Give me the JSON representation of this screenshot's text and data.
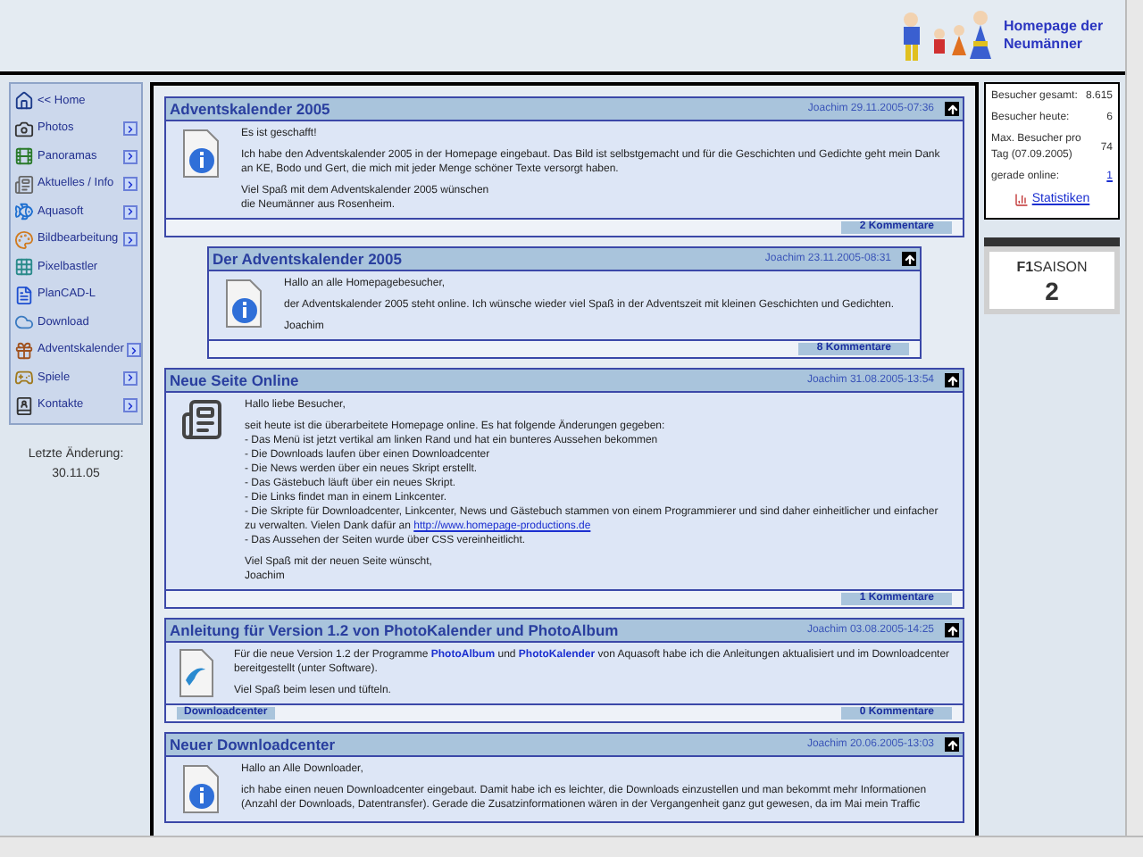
{
  "header": {
    "logo_text": "Homepage der Neumänner"
  },
  "sidebar": {
    "items": [
      {
        "label": "<< Home",
        "submenu": false
      },
      {
        "label": "Photos",
        "submenu": true
      },
      {
        "label": "Panoramas",
        "submenu": true
      },
      {
        "label": "Aktuelles / Info",
        "submenu": true
      },
      {
        "label": "Aquasoft",
        "submenu": true
      },
      {
        "label": "Bildbearbeitung",
        "submenu": true
      },
      {
        "label": "Pixelbastler",
        "submenu": false
      },
      {
        "label": "PlanCAD-L",
        "submenu": false
      },
      {
        "label": "Download",
        "submenu": false
      },
      {
        "label": "Adventskalender",
        "submenu": true
      },
      {
        "label": "Spiele",
        "submenu": true
      },
      {
        "label": "Kontakte",
        "submenu": true
      }
    ],
    "last_change_label": "Letzte Änderung:",
    "last_change_date": "30.11.05"
  },
  "posts": [
    {
      "title": "Adventskalender 2005",
      "meta": "Joachim 29.11.2005-07:36",
      "nested": false,
      "kind": "info",
      "comments": "2 Kommentare",
      "paragraphs": [
        [
          "Es ist geschafft!"
        ],
        [
          "Ich habe den Adventskalender 2005 in der Homepage eingebaut. Das Bild ist selbstgemacht und für die Geschichten und Gedichte geht mein Dank an KE, Bodo und Gert, die mich mit jeder Menge schöner Texte versorgt haben."
        ],
        [
          "Viel Spaß mit dem Adventskalender 2005 wünschen",
          "die Neumänner aus Rosenheim."
        ]
      ]
    },
    {
      "title": "Der Adventskalender 2005",
      "meta": "Joachim 23.11.2005-08:31",
      "nested": true,
      "kind": "info",
      "comments": "8 Kommentare",
      "paragraphs": [
        [
          "Hallo an alle Homepagebesucher,"
        ],
        [
          "der Adventskalender 2005 steht online. Ich wünsche wieder viel Spaß in der Adventszeit mit kleinen Geschichten und Gedichten."
        ],
        [
          "Joachim"
        ]
      ]
    },
    {
      "title": "Neue Seite Online",
      "meta": "Joachim 31.08.2005-13:54",
      "nested": false,
      "kind": "newspaper",
      "comments": "1 Kommentare",
      "paragraphs": [
        [
          "Hallo liebe Besucher,"
        ],
        [
          "seit heute ist die überarbeitete Homepage online. Es hat folgende Änderungen gegeben:",
          "- Das Menü ist jetzt vertikal am linken Rand und hat ein bunteres Aussehen bekommen",
          "- Die Downloads laufen über einen Downloadcenter",
          "- Die News werden über ein neues Skript erstellt.",
          "- Das Gästebuch läuft über ein neues Skript.",
          "- Die Links findet man in einem Linkcenter.",
          [
            {
              "kind": "text",
              "text": "- Die Skripte für Downloadcenter, Linkcenter, News und Gästebuch stammen von einem Programmierer und sind daher einheitlicher und einfacher zu verwalten. Vielen Dank dafür an "
            },
            {
              "kind": "link",
              "text": "http://www.homepage-productions.de"
            }
          ],
          "- Das Aussehen der Seiten wurde über CSS vereinheitlicht."
        ],
        [
          "Viel Spaß mit der neuen Seite wünscht,",
          "Joachim"
        ]
      ]
    },
    {
      "title": "Anleitung für Version 1.2 von PhotoKalender und PhotoAlbum",
      "meta": "Joachim 03.08.2005-14:25",
      "nested": false,
      "kind": "document",
      "footer_link": "Downloadcenter",
      "comments": "0 Kommentare",
      "paragraphs": [
        [
          [
            {
              "kind": "text",
              "text": "Für die neue Version 1.2 der Programme "
            },
            {
              "kind": "strong",
              "text": "PhotoAlbum"
            },
            {
              "kind": "text",
              "text": " und "
            },
            {
              "kind": "strong",
              "text": "PhotoKalender"
            },
            {
              "kind": "text",
              "text": " von Aquasoft habe ich die Anleitungen aktualisiert und im Downloadcenter bereitgestellt (unter Software)."
            }
          ]
        ],
        [
          "Viel Spaß beim lesen und tüfteln."
        ]
      ]
    },
    {
      "title": "Neuer Downloadcenter",
      "meta": "Joachim 20.06.2005-13:03",
      "nested": false,
      "kind": "info",
      "paragraphs": [
        [
          "Hallo an Alle Downloader,"
        ],
        [
          "ich habe einen neuen Downloadcenter eingebaut. Damit habe ich es leichter, die Downloads einzustellen und man bekommt mehr Informationen (Anzahl der Downloads, Datentransfer). Gerade die Zusatzinformationen wären in der Vergangenheit ganz gut gewesen, da im Mai mein Traffic"
        ]
      ]
    }
  ],
  "stats": {
    "rows": [
      {
        "label": "Besucher gesamt:",
        "value": "8.615",
        "kind": "plain"
      },
      {
        "label": "Besucher heute:",
        "value": "6",
        "kind": "plain"
      },
      {
        "label": "Max. Besucher pro Tag (07.09.2005)",
        "value": "74",
        "kind": "plain"
      },
      {
        "label": "gerade online:",
        "value": "1",
        "kind": "link"
      }
    ],
    "link": "Statistiken"
  },
  "badge": {
    "text": "**F1**SAISON",
    "number": "2"
  }
}
